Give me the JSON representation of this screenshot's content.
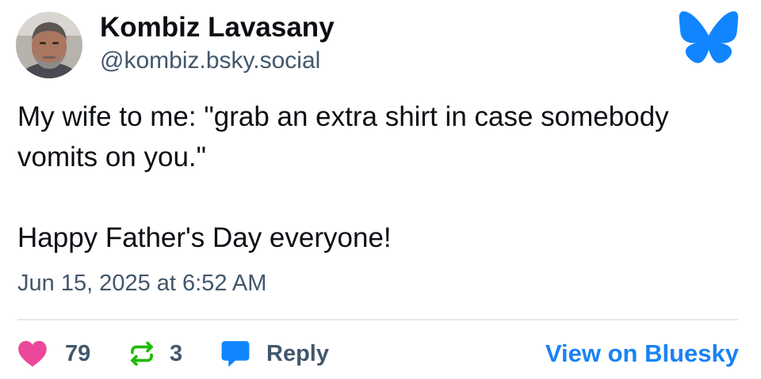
{
  "author": {
    "display_name": "Kombiz Lavasany",
    "handle": "@kombiz.bsky.social",
    "avatar_icon": "avatar-photo"
  },
  "post": {
    "lines": [
      "My wife to me: \"grab an extra shirt in case somebody vomits on you.\"",
      "Happy Father's Day everyone!"
    ],
    "timestamp": "Jun 15, 2025 at 6:52 AM"
  },
  "actions": {
    "likes": "79",
    "reposts": "3",
    "reply_label": "Reply",
    "view_link_label": "View on Bluesky"
  },
  "icons": {
    "logo": "bluesky-butterfly-icon",
    "like": "heart-icon",
    "repost": "repost-icon",
    "reply": "speech-bubble-icon"
  },
  "colors": {
    "brand_blue": "#1185fe",
    "like_pink": "#ec4899",
    "repost_green": "#20bc07",
    "link_blue": "#1a82f5",
    "muted_text": "#42576c"
  }
}
